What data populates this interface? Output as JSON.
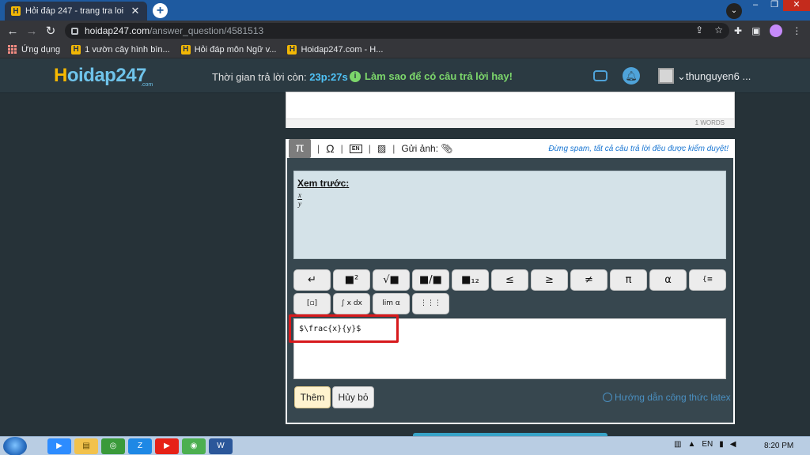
{
  "browser": {
    "tab_title": "Hỏi đáp 247 - trang tra loi",
    "tab_close": "✕",
    "new_tab": "+",
    "url_host": "hoidap247.com",
    "url_path": "/answer_question/4581513",
    "bookmarks": [
      {
        "label": "Ứng dụng",
        "icon": "apps-icon"
      },
      {
        "label": "1 vườn cây hình bìn...",
        "icon": "hoidap-favicon"
      },
      {
        "label": "Hỏi đáp môn Ngữ v...",
        "icon": "hoidap-favicon"
      },
      {
        "label": "Hoidap247.com - H...",
        "icon": "hoidap-favicon"
      }
    ]
  },
  "site": {
    "logo": "Hoidap247",
    "logo_sub": ".com",
    "timer_label": "Thời gian trả lời còn:",
    "timer_value": "23p:27s",
    "tip": "Làm sao để có câu trả lời hay!",
    "username": "thunguyen6 ..."
  },
  "editor": {
    "word_count": "1 WORDS",
    "photo_label": "Gửi ảnh:",
    "warning": "Đừng spam, tất cả câu trả lời đều được kiểm duyệt!",
    "preview_title": "Xem trước:",
    "preview_num": "x",
    "preview_den": "y",
    "latex_input": "$\\frac{x}{y}$",
    "add_button": "Thêm",
    "cancel_button": "Hủy bỏ",
    "latex_guide": "Hướng dẫn công thức latex",
    "symbols_row1": [
      "↵",
      "■²",
      "√■",
      "■/■",
      "■₁₂",
      "≤",
      "≥",
      "≠",
      "π",
      "α",
      "{≡"
    ],
    "symbols_row2": [
      "[▫]",
      "∫ x dx",
      "lim α",
      "⋮⋮⋮"
    ]
  },
  "taskbar": {
    "lang": "EN",
    "time": "8:20 PM"
  },
  "colors": {
    "site_bg": "#263238",
    "accent_blue": "#4fc3f7",
    "tip_green": "#7cd66b",
    "highlight_red": "#d7191c"
  }
}
